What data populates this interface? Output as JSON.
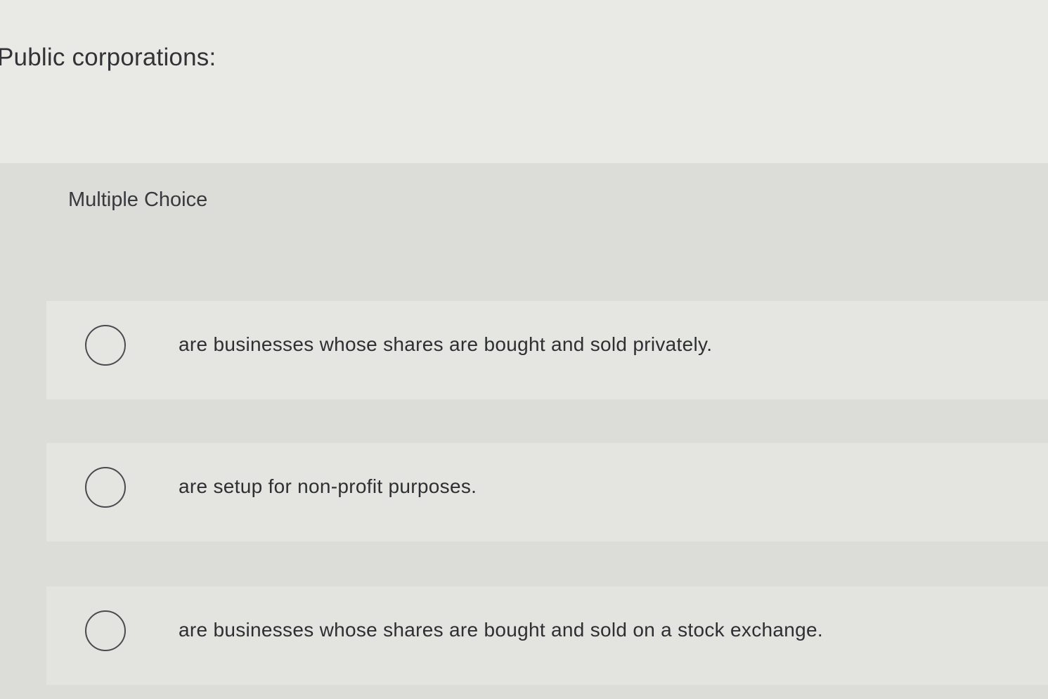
{
  "question": {
    "prompt": "Public corporations:"
  },
  "choices_section": {
    "label": "Multiple Choice",
    "options": [
      {
        "text": "are businesses whose shares are bought and sold privately."
      },
      {
        "text": "are setup for non-profit purposes."
      },
      {
        "text": "are businesses whose shares are bought and sold on a stock exchange."
      }
    ]
  },
  "icons": {
    "radio": "radio-unchecked-icon"
  },
  "colors": {
    "background": "#e9e9e6",
    "panel": "#dcdcd9",
    "text": "#2f3033",
    "radio_border": "#4a4b4e"
  }
}
